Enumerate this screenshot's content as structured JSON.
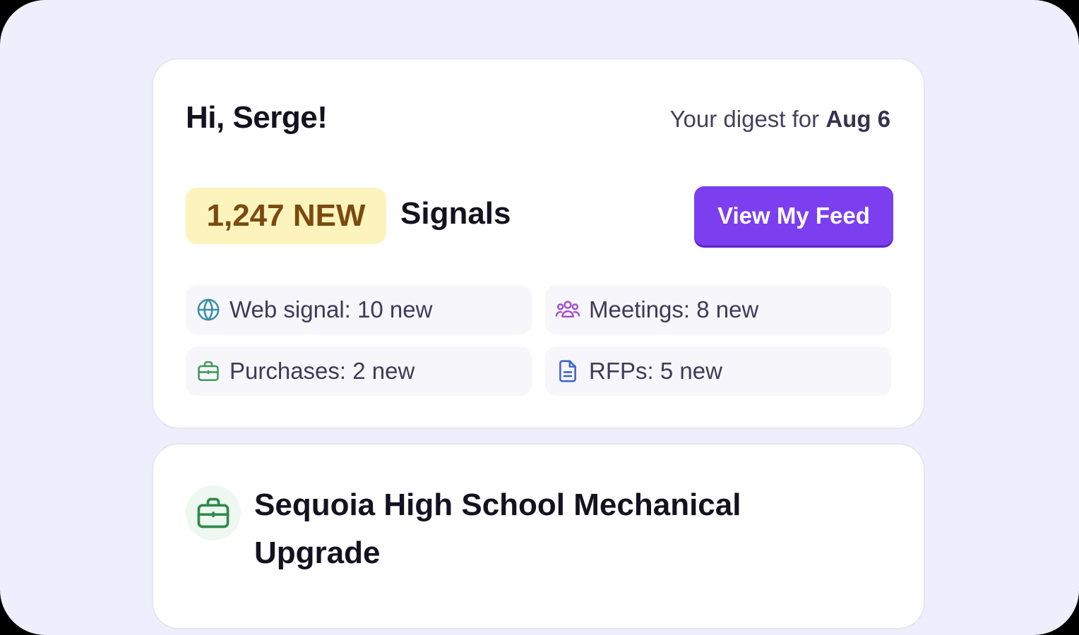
{
  "digest": {
    "greeting": "Hi, Serge!",
    "digest_prefix": "Your digest for ",
    "digest_date": "Aug 6",
    "new_count_badge": "1,247 NEW",
    "signals_label": "Signals",
    "feed_button_label": "View My Feed",
    "stats": [
      {
        "label": "Web signal: 10 new",
        "icon": "globe-icon",
        "color": "#3a8fa8"
      },
      {
        "label": "Meetings: 8 new",
        "icon": "people-icon",
        "color": "#a550c8"
      },
      {
        "label": "Purchases: 2 new",
        "icon": "briefcase-icon",
        "color": "#3f9a5c"
      },
      {
        "label": "RFPs: 5 new",
        "icon": "document-icon",
        "color": "#3e63c6"
      }
    ]
  },
  "item": {
    "icon": "briefcase-icon",
    "title": "Sequoia High School Mechanical Upgrade"
  },
  "colors": {
    "accent": "#7b3ff0",
    "badge_bg": "#fdf4bd",
    "badge_text": "#7b4a0f",
    "page_bg": "#eeeefc"
  }
}
